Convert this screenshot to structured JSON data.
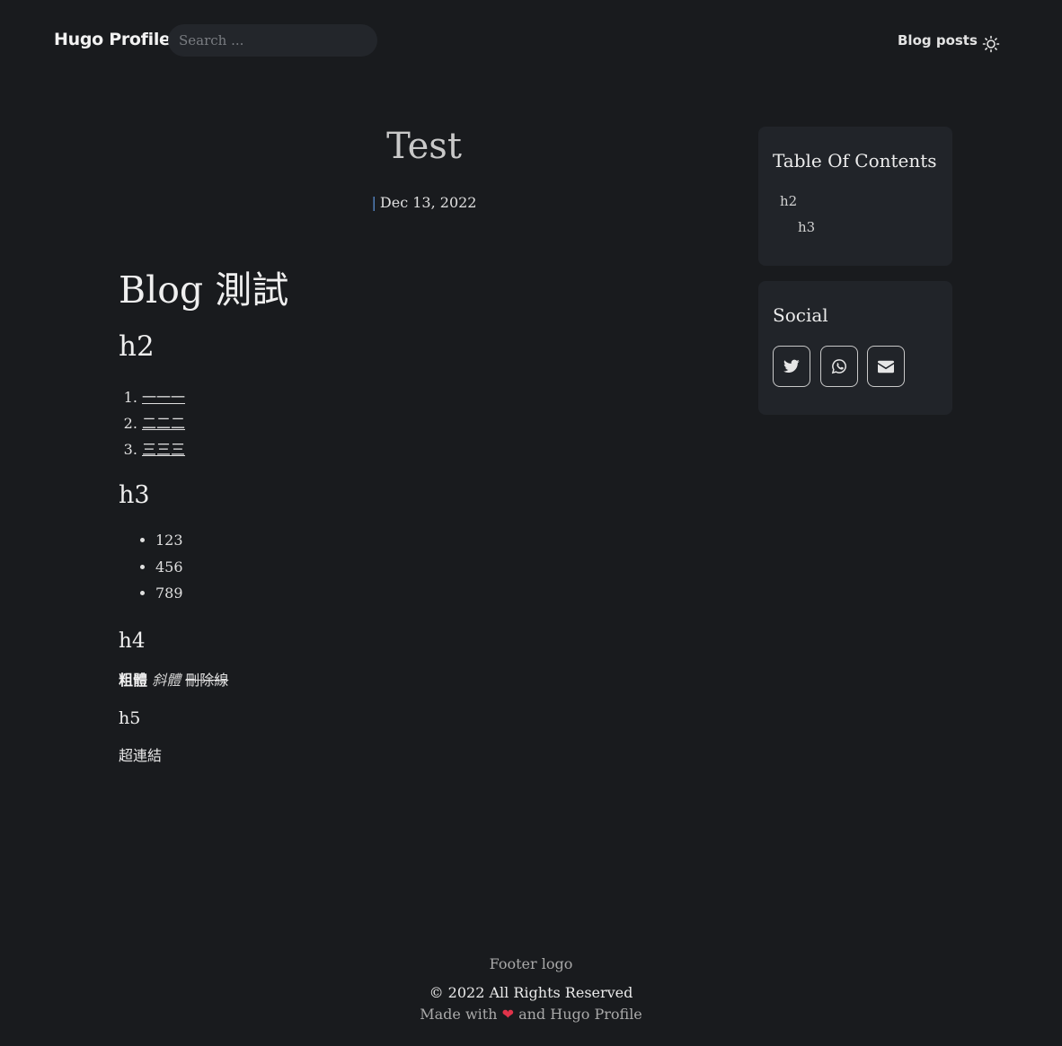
{
  "nav": {
    "brand": "Hugo Profile",
    "search_placeholder": "Search ...",
    "blog_posts": "Blog posts",
    "theme_icon": "sun-icon"
  },
  "post": {
    "title": "Test",
    "meta_separator": "|",
    "date": "Dec 13, 2022",
    "h1": "Blog 測試",
    "h2": "h2",
    "ordered": [
      "一一一",
      "二二二",
      "三三三"
    ],
    "h3": "h3",
    "unordered": [
      "123",
      "456",
      "789"
    ],
    "h4": "h4",
    "bold": "粗體",
    "italic": "斜體",
    "strike": "刪除線",
    "h5": "h5",
    "link": "超連結"
  },
  "toc": {
    "title": "Table Of Contents",
    "items": [
      "h2",
      "h3"
    ]
  },
  "social": {
    "title": "Social",
    "icons": [
      "twitter-icon",
      "whatsapp-icon",
      "email-icon"
    ]
  },
  "footer": {
    "logo": "Footer logo",
    "copyright": "© 2022 All Rights Reserved",
    "made_prefix": "Made with",
    "heart": "❤",
    "made_suffix": "and Hugo Profile"
  },
  "colors": {
    "background": "#191b1e",
    "card": "#212429",
    "heart": "#e0334a"
  }
}
